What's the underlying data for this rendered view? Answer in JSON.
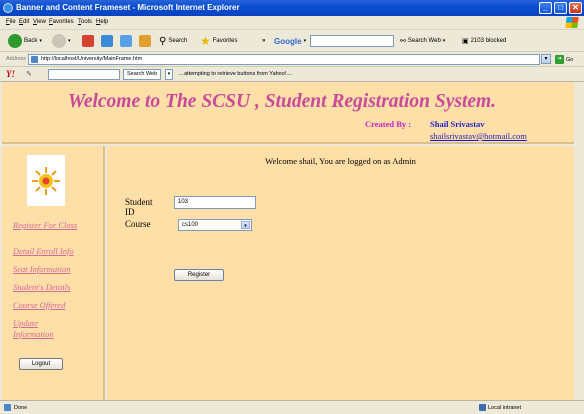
{
  "window": {
    "title": "Banner and Content Frameset - Microsoft Internet Explorer",
    "minimize": "_",
    "maximize": "□",
    "close": "✕"
  },
  "menu": [
    "File",
    "Edit",
    "View",
    "Favorites",
    "Tools",
    "Help"
  ],
  "toolbar": {
    "back": "Back",
    "search": "Search",
    "favorites": "Favorites",
    "chevron": "»",
    "google": "Google",
    "search_web": "Search Web",
    "blocked": "2103 blocked"
  },
  "address": {
    "label": "Address",
    "url": "http://localhost/University/MainFrame.htm",
    "go": "Go"
  },
  "yahoo": {
    "logo": "Y!",
    "search_button": "Search Web",
    "message": "....attempting to retrieve buttons from Yahoo!...."
  },
  "banner": {
    "title": "Welcome to The SCSU , Student Registration System.",
    "created_by": "Created By :",
    "author": "Shail Srivastav",
    "email": "shailsrivastav@hotmail.com"
  },
  "nav": {
    "links": [
      "Register For Class",
      "Detail Enroll Info",
      "Seat Information",
      "Student's Details",
      "Course Offered",
      "Update Information"
    ],
    "logout": "Logout"
  },
  "main": {
    "welcome": "Welcome shail, You are logged on as Admin",
    "student_id_label_1": "Student",
    "student_id_label_2": "ID",
    "student_id_value": "103",
    "course_label": "Course",
    "course_value": "cs100",
    "register": "Register"
  },
  "status": {
    "text": "Done",
    "zone": "Local intranet"
  }
}
